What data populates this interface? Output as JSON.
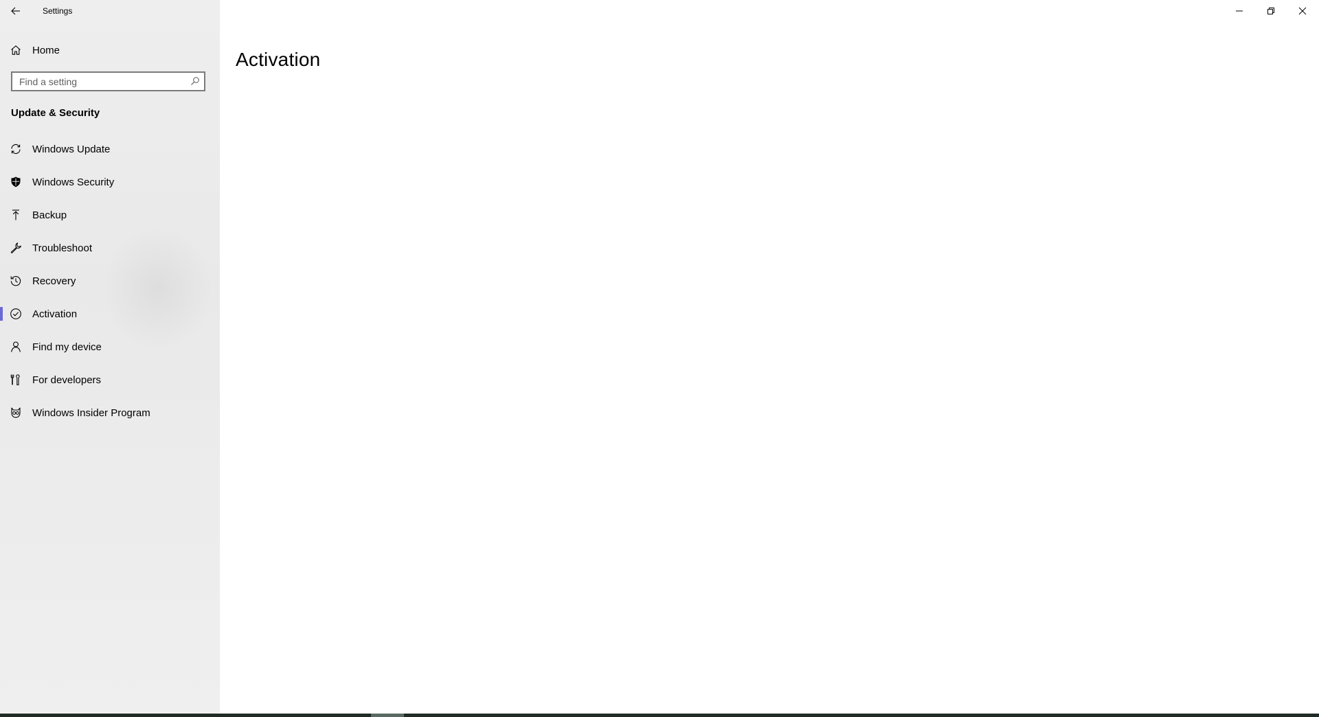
{
  "window": {
    "title": "Settings"
  },
  "caption_buttons": {
    "minimize_icon": "minimize-icon",
    "restore_icon": "restore-icon",
    "close_icon": "close-icon"
  },
  "sidebar": {
    "home_label": "Home",
    "search": {
      "placeholder": "Find a setting",
      "value": ""
    },
    "section_title": "Update & Security",
    "items": [
      {
        "label": "Windows Update",
        "icon": "sync-icon",
        "selected": false
      },
      {
        "label": "Windows Security",
        "icon": "shield-icon",
        "selected": false
      },
      {
        "label": "Backup",
        "icon": "backup-arrow-icon",
        "selected": false
      },
      {
        "label": "Troubleshoot",
        "icon": "wrench-icon",
        "selected": false
      },
      {
        "label": "Recovery",
        "icon": "history-icon",
        "selected": false
      },
      {
        "label": "Activation",
        "icon": "check-circle-icon",
        "selected": true
      },
      {
        "label": "Find my device",
        "icon": "person-pin-icon",
        "selected": false
      },
      {
        "label": "For developers",
        "icon": "developer-tools-icon",
        "selected": false
      },
      {
        "label": "Windows Insider Program",
        "icon": "insider-cat-icon",
        "selected": false
      }
    ]
  },
  "main": {
    "title": "Activation"
  },
  "colors": {
    "accent": "#6b69d6",
    "sidebar_bg": "#ececec",
    "content_bg": "#ffffff"
  }
}
